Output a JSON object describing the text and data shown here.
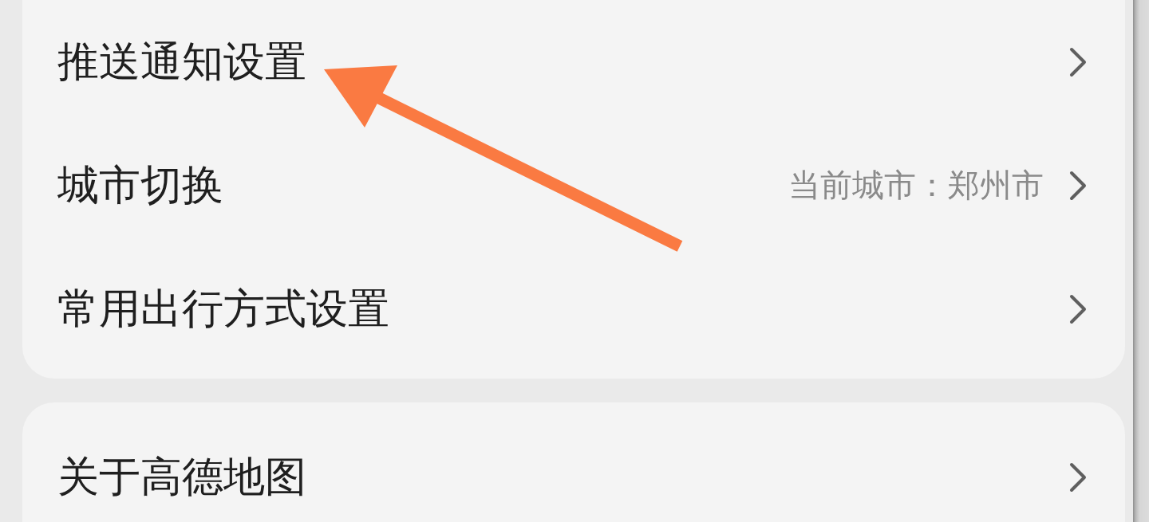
{
  "groups": [
    {
      "items": [
        {
          "label": "推送通知设置"
        },
        {
          "label": "城市切换",
          "value": "当前城市：郑州市"
        },
        {
          "label": "常用出行方式设置"
        }
      ]
    },
    {
      "items": [
        {
          "label": "关于高德地图"
        }
      ]
    }
  ]
}
